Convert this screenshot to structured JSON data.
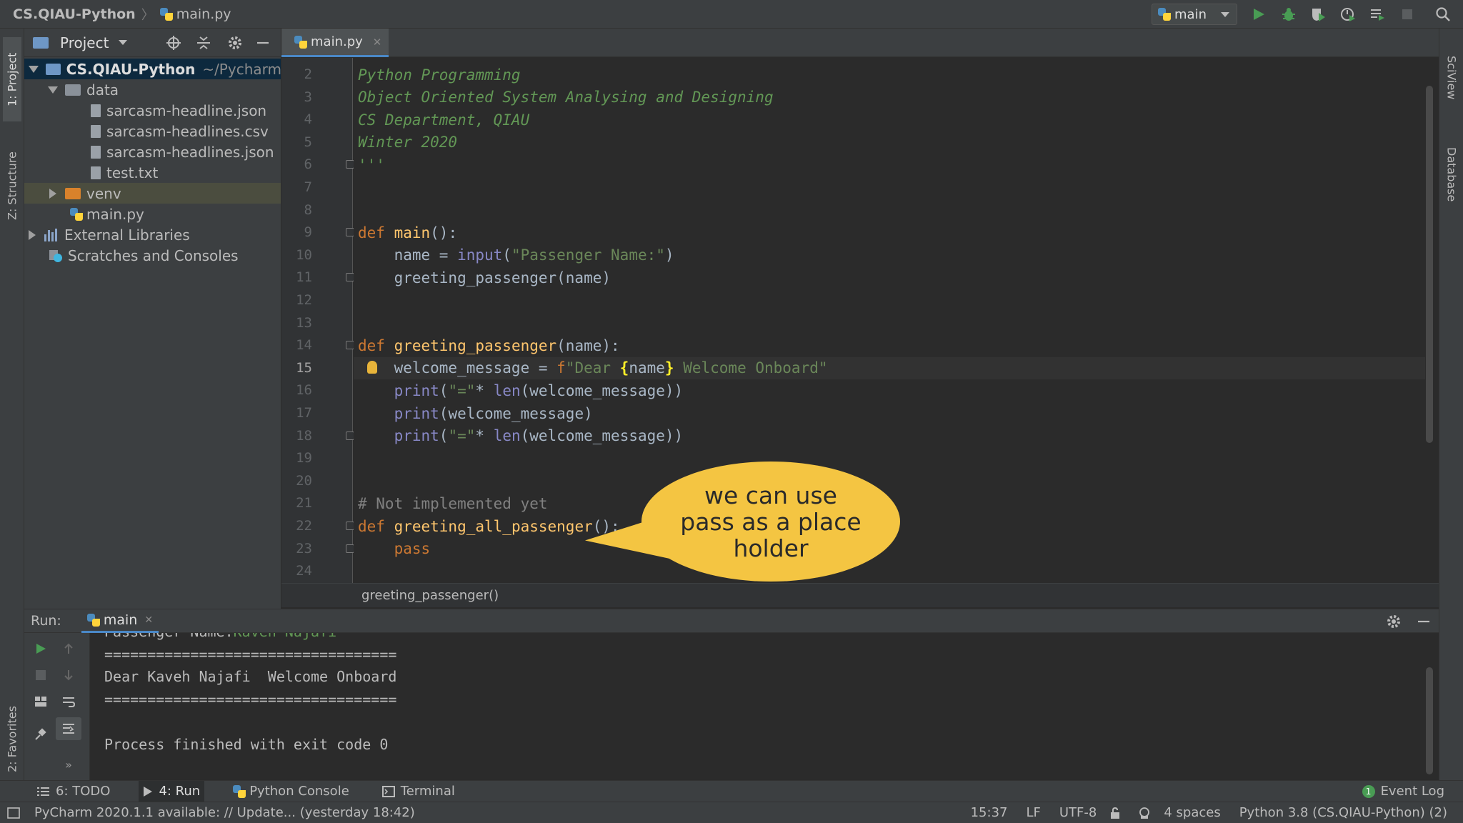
{
  "nav": {
    "project": "CS.QIAU-Python",
    "file": "main.py",
    "run_config": "main"
  },
  "left_strip": {
    "project_tab": "1: Project",
    "structure_tab": "Z: Structure",
    "favorites_tab": "2: Favorites"
  },
  "right_strip": {
    "sciview_tab": "SciView",
    "database_tab": "Database"
  },
  "project_panel": {
    "title": "Project",
    "tree": [
      {
        "label": "CS.QIAU-Python",
        "suffix": "~/Pycharm"
      },
      {
        "label": "data"
      },
      {
        "label": "sarcasm-headline.json"
      },
      {
        "label": "sarcasm-headlines.csv"
      },
      {
        "label": "sarcasm-headlines.json"
      },
      {
        "label": "test.txt"
      },
      {
        "label": "venv"
      },
      {
        "label": "main.py"
      },
      {
        "label": "External Libraries"
      },
      {
        "label": "Scratches and Consoles"
      }
    ]
  },
  "editor": {
    "tab": "main.py",
    "breadcrumb": "greeting_passenger()",
    "current_line": 15,
    "lines": [
      {
        "n": "2",
        "parts": [
          {
            "t": "Python Programming",
            "c": "doc"
          }
        ]
      },
      {
        "n": "3",
        "parts": [
          {
            "t": "Object Oriented System Analysing and Designing",
            "c": "doc"
          }
        ]
      },
      {
        "n": "4",
        "parts": [
          {
            "t": "CS Department, QIAU",
            "c": "doc"
          }
        ]
      },
      {
        "n": "5",
        "parts": [
          {
            "t": "Winter 2020",
            "c": "doc"
          }
        ]
      },
      {
        "n": "6",
        "parts": [
          {
            "t": "'''",
            "c": "doc"
          }
        ]
      },
      {
        "n": "7",
        "parts": []
      },
      {
        "n": "8",
        "parts": []
      },
      {
        "n": "9",
        "parts": [
          {
            "t": "def ",
            "c": "kw"
          },
          {
            "t": "main",
            "c": "fn"
          },
          {
            "t": "():",
            "c": ""
          }
        ]
      },
      {
        "n": "10",
        "parts": [
          {
            "t": "    name = ",
            "c": ""
          },
          {
            "t": "input",
            "c": "bi"
          },
          {
            "t": "(",
            "c": ""
          },
          {
            "t": "\"Passenger Name:\"",
            "c": "str"
          },
          {
            "t": ")",
            "c": ""
          }
        ]
      },
      {
        "n": "11",
        "parts": [
          {
            "t": "    greeting_passenger(name)",
            "c": ""
          }
        ]
      },
      {
        "n": "12",
        "parts": []
      },
      {
        "n": "13",
        "parts": []
      },
      {
        "n": "14",
        "parts": [
          {
            "t": "def ",
            "c": "kw"
          },
          {
            "t": "greeting_passenger",
            "c": "fn"
          },
          {
            "t": "(name):",
            "c": ""
          }
        ]
      },
      {
        "n": "15",
        "parts": [
          {
            "t": "    welcome_message = ",
            "c": ""
          },
          {
            "t": "f",
            "c": "kw"
          },
          {
            "t": "\"Dear ",
            "c": "str"
          },
          {
            "t": "{",
            "c": "br"
          },
          {
            "t": "name",
            "c": ""
          },
          {
            "t": "}",
            "c": "br"
          },
          {
            "t": " Welcome Onboard\"",
            "c": "str"
          }
        ]
      },
      {
        "n": "16",
        "parts": [
          {
            "t": "    ",
            "c": ""
          },
          {
            "t": "print",
            "c": "bi"
          },
          {
            "t": "(",
            "c": ""
          },
          {
            "t": "\"=\"",
            "c": "str"
          },
          {
            "t": "* ",
            "c": ""
          },
          {
            "t": "len",
            "c": "bi"
          },
          {
            "t": "(welcome_message))",
            "c": ""
          }
        ]
      },
      {
        "n": "17",
        "parts": [
          {
            "t": "    ",
            "c": ""
          },
          {
            "t": "print",
            "c": "bi"
          },
          {
            "t": "(welcome_message)",
            "c": ""
          }
        ]
      },
      {
        "n": "18",
        "parts": [
          {
            "t": "    ",
            "c": ""
          },
          {
            "t": "print",
            "c": "bi"
          },
          {
            "t": "(",
            "c": ""
          },
          {
            "t": "\"=\"",
            "c": "str"
          },
          {
            "t": "* ",
            "c": ""
          },
          {
            "t": "len",
            "c": "bi"
          },
          {
            "t": "(welcome_message))",
            "c": ""
          }
        ]
      },
      {
        "n": "19",
        "parts": []
      },
      {
        "n": "20",
        "parts": []
      },
      {
        "n": "21",
        "parts": [
          {
            "t": "# Not implemented yet",
            "c": "cm"
          }
        ]
      },
      {
        "n": "22",
        "parts": [
          {
            "t": "def ",
            "c": "kw"
          },
          {
            "t": "greeting_all_passenger",
            "c": "fn"
          },
          {
            "t": "():",
            "c": ""
          }
        ]
      },
      {
        "n": "23",
        "parts": [
          {
            "t": "    pass",
            "c": "kw"
          }
        ]
      },
      {
        "n": "24",
        "parts": []
      }
    ]
  },
  "callout": {
    "line1": "we can use",
    "line2": "pass as a place",
    "line3": "holder"
  },
  "run_panel": {
    "label": "Run:",
    "tab": "main",
    "output": [
      {
        "text": "Passenger Name:",
        "input": "Kaveh Najafi"
      },
      {
        "text": "=================================="
      },
      {
        "text": "Dear Kaveh Najafi  Welcome Onboard"
      },
      {
        "text": "=================================="
      },
      {
        "text": ""
      },
      {
        "text": "Process finished with exit code 0"
      }
    ]
  },
  "tool_tabs": {
    "todo": "6: TODO",
    "run": "4: Run",
    "python_console": "Python Console",
    "terminal": "Terminal",
    "event_log": "Event Log",
    "event_count": "1"
  },
  "status": {
    "message": "PyCharm 2020.1.1 available: // Update... (yesterday 18:42)",
    "position": "15:37",
    "line_sep": "LF",
    "encoding": "UTF-8",
    "indent": "4 spaces",
    "interpreter": "Python 3.8 (CS.QIAU-Python) (2)"
  },
  "colors": {
    "accent": "#4a88c7",
    "callout": "#f4c542",
    "run_green": "#499c54"
  }
}
